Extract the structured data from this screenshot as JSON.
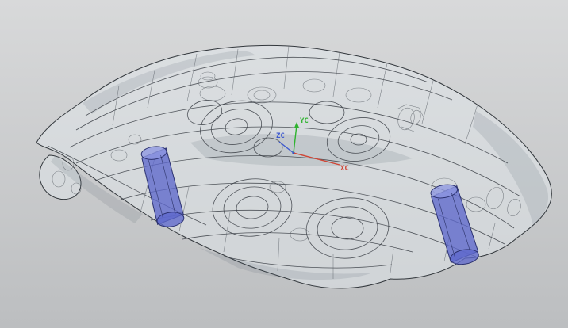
{
  "wcs": {
    "labels": {
      "x": "XC",
      "y": "YC",
      "z": "ZC"
    },
    "colors": {
      "x": "#cf4636",
      "y": "#2fb32f",
      "z": "#3d59d0"
    }
  },
  "colors": {
    "background_top": "#d8d9da",
    "background_bottom": "#bcbec0",
    "edge": "#3f444a",
    "body_glass": "rgba(226,232,235,0.5)",
    "piston": "#5e68cc",
    "piston_light": "#8e97e2",
    "piston_dark": "#2c3270"
  }
}
